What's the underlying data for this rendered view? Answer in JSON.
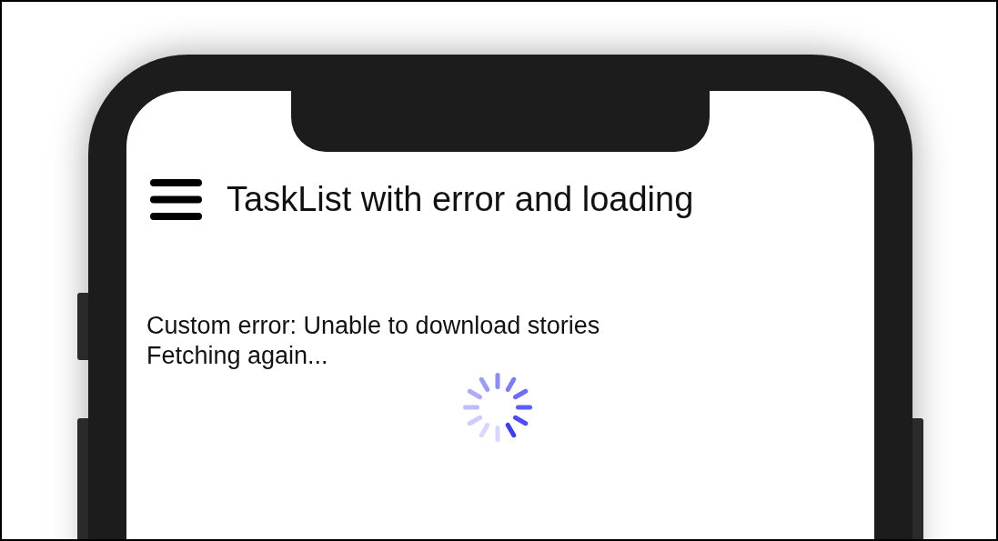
{
  "screen": {
    "title": "TaskList with error and loading",
    "messages": [
      "Custom error: Unable to download stories",
      "Fetching again..."
    ],
    "loading": true
  }
}
